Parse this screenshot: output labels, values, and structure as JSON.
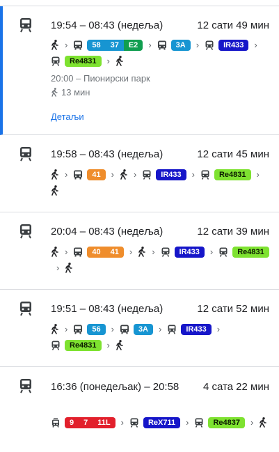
{
  "cards": [
    {
      "times": "19:54 – 08:43 (недеља)",
      "duration": "12 сати 49 мин",
      "steps": [
        {
          "type": "walk"
        },
        {
          "type": "bus",
          "badges": [
            {
              "t": "58",
              "c": "#1795d2",
              "fg": "#fff"
            },
            {
              "t": "37",
              "c": "#1795d2",
              "fg": "#fff"
            },
            {
              "t": "E2",
              "c": "#109e4f",
              "fg": "#fff"
            }
          ]
        },
        {
          "type": "bus",
          "badges": [
            {
              "t": "3A",
              "c": "#1795d2",
              "fg": "#fff"
            }
          ]
        },
        {
          "type": "train",
          "badges": [
            {
              "t": "IR433",
              "c": "#1616c9",
              "fg": "#fff"
            }
          ]
        },
        {
          "type": "train",
          "badges": [
            {
              "t": "Re4831",
              "c": "#7ee230",
              "fg": "#0b1a00"
            }
          ]
        },
        {
          "type": "walk"
        }
      ],
      "departure_info": "20:00 – Пионирски парк",
      "walk_info": "13 мин",
      "details_label": "Детаљи"
    },
    {
      "times": "19:58 – 08:43 (недеља)",
      "duration": "12 сати 45 мин",
      "steps": [
        {
          "type": "walk"
        },
        {
          "type": "bus",
          "badges": [
            {
              "t": "41",
              "c": "#ef8d2c",
              "fg": "#fff"
            }
          ]
        },
        {
          "type": "walk"
        },
        {
          "type": "train",
          "badges": [
            {
              "t": "IR433",
              "c": "#1616c9",
              "fg": "#fff"
            }
          ]
        },
        {
          "type": "train",
          "badges": [
            {
              "t": "Re4831",
              "c": "#7ee230",
              "fg": "#0b1a00"
            }
          ]
        },
        {
          "type": "walk"
        }
      ]
    },
    {
      "times": "20:04 – 08:43 (недеља)",
      "duration": "12 сати 39 мин",
      "steps": [
        {
          "type": "walk"
        },
        {
          "type": "bus",
          "badges": [
            {
              "t": "40",
              "c": "#ef8d2c",
              "fg": "#fff"
            },
            {
              "t": "41",
              "c": "#ef8d2c",
              "fg": "#fff"
            }
          ]
        },
        {
          "type": "walk"
        },
        {
          "type": "train",
          "badges": [
            {
              "t": "IR433",
              "c": "#1616c9",
              "fg": "#fff"
            }
          ]
        },
        {
          "type": "train",
          "badges": [
            {
              "t": "Re4831",
              "c": "#7ee230",
              "fg": "#0b1a00"
            }
          ]
        },
        {
          "type": "walk"
        }
      ]
    },
    {
      "times": "19:51 – 08:43 (недеља)",
      "duration": "12 сати 52 мин",
      "steps": [
        {
          "type": "walk"
        },
        {
          "type": "bus",
          "badges": [
            {
              "t": "56",
              "c": "#1795d2",
              "fg": "#fff"
            }
          ]
        },
        {
          "type": "bus",
          "badges": [
            {
              "t": "3A",
              "c": "#1795d2",
              "fg": "#fff"
            }
          ]
        },
        {
          "type": "train",
          "badges": [
            {
              "t": "IR433",
              "c": "#1616c9",
              "fg": "#fff"
            }
          ]
        },
        {
          "type": "train",
          "badges": [
            {
              "t": "Re4831",
              "c": "#7ee230",
              "fg": "#0b1a00"
            }
          ]
        },
        {
          "type": "walk"
        }
      ]
    },
    {
      "times": "16:36 (понедељак) – 20:58",
      "duration": "4 сата 22 мин",
      "steps": [
        {
          "type": "tram",
          "badges": [
            {
              "t": "9",
              "c": "#e2202c",
              "fg": "#fff"
            },
            {
              "t": "7",
              "c": "#e2202c",
              "fg": "#fff"
            },
            {
              "t": "11L",
              "c": "#e2202c",
              "fg": "#fff"
            }
          ]
        },
        {
          "type": "train",
          "badges": [
            {
              "t": "ReX711",
              "c": "#1616c9",
              "fg": "#fff"
            }
          ]
        },
        {
          "type": "train",
          "badges": [
            {
              "t": "Re4837",
              "c": "#7ee230",
              "fg": "#0b1a00"
            }
          ]
        },
        {
          "type": "walk"
        }
      ]
    }
  ]
}
